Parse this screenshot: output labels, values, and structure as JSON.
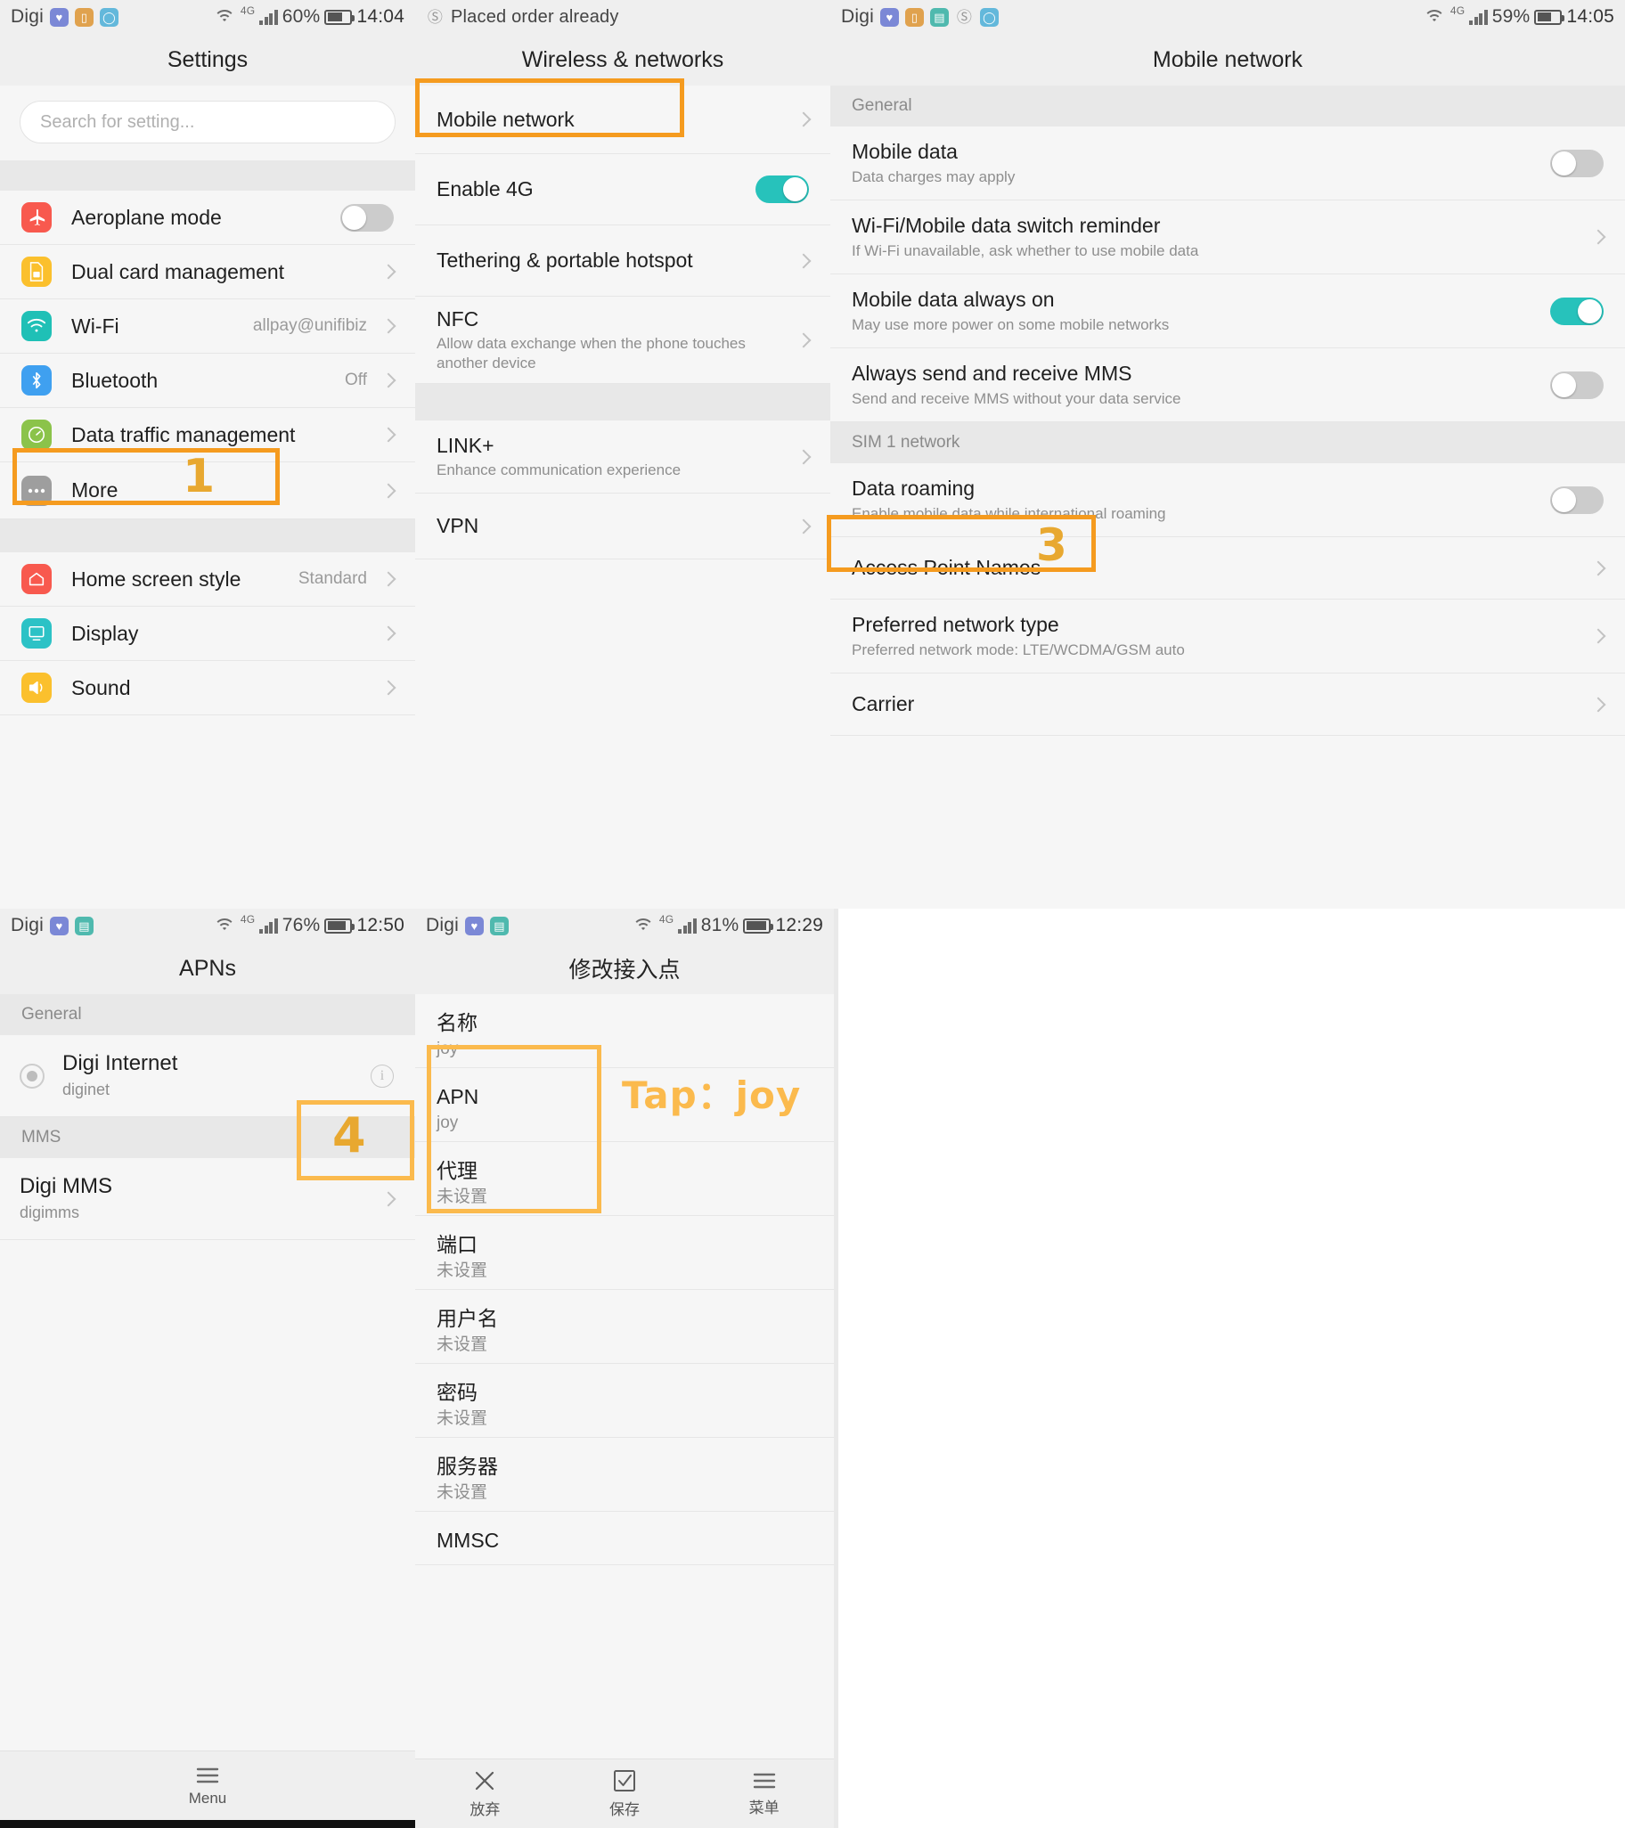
{
  "accent": {
    "strong": "#F59B1F",
    "soft": "#FBBA4D",
    "number": "#E8A830",
    "toggle_on": "#27c2bb"
  },
  "panels": {
    "settings": {
      "status": {
        "carrier": "Digi",
        "percent": "60%",
        "clock": "14:04",
        "network": "4G"
      },
      "title": "Settings",
      "search_placeholder": "Search for setting...",
      "items": [
        {
          "label": "Aeroplane mode",
          "value": "",
          "icon": "aeroplane-icon",
          "control": "toggle-off"
        },
        {
          "label": "Dual card management",
          "value": "",
          "icon": "sim-card-icon",
          "control": "chevron"
        },
        {
          "label": "Wi-Fi",
          "value": "allpay@unifibiz",
          "icon": "wifi-icon",
          "control": "chevron"
        },
        {
          "label": "Bluetooth",
          "value": "Off",
          "icon": "bluetooth-icon",
          "control": "chevron"
        },
        {
          "label": "Data traffic management",
          "value": "",
          "icon": "speedometer-icon",
          "control": "chevron"
        },
        {
          "label": "More",
          "value": "",
          "icon": "more-dots-icon",
          "control": "chevron"
        }
      ],
      "items2": [
        {
          "label": "Home screen style",
          "value": "Standard",
          "icon": "home-icon",
          "control": "chevron"
        },
        {
          "label": "Display",
          "value": "",
          "icon": "display-icon",
          "control": "chevron"
        },
        {
          "label": "Sound",
          "value": "",
          "icon": "sound-icon",
          "control": "chevron"
        }
      ],
      "highlight_number": "1"
    },
    "wireless": {
      "status": {
        "notification": "Placed order already"
      },
      "title": "Wireless & networks",
      "items": [
        {
          "label": "Mobile network",
          "sub": "",
          "control": "chevron"
        },
        {
          "label": "Enable 4G",
          "sub": "",
          "control": "toggle-on"
        },
        {
          "label": "Tethering & portable hotspot",
          "sub": "",
          "control": "chevron"
        },
        {
          "label": "NFC",
          "sub": "Allow data exchange when the phone touches another device",
          "control": "chevron"
        }
      ],
      "items2": [
        {
          "label": "LINK+",
          "sub": "Enhance communication experience",
          "control": "chevron"
        },
        {
          "label": "VPN",
          "sub": "",
          "control": "chevron"
        }
      ]
    },
    "mobile_network": {
      "status": {
        "carrier": "Digi",
        "percent": "59%",
        "clock": "14:05",
        "network": "4G"
      },
      "title": "Mobile network",
      "group_general": "General",
      "general_items": [
        {
          "label": "Mobile data",
          "sub": "Data charges may apply",
          "control": "toggle-off"
        },
        {
          "label": "Wi-Fi/Mobile data switch reminder",
          "sub": "If Wi-Fi unavailable, ask whether to use mobile data",
          "control": "chevron"
        },
        {
          "label": "Mobile data always on",
          "sub": "May use more power on some mobile networks",
          "control": "toggle-on"
        },
        {
          "label": "Always send and receive MMS",
          "sub": "Send and receive MMS without your data service",
          "control": "toggle-off"
        }
      ],
      "group_sim": "SIM 1 network",
      "sim_items": [
        {
          "label": "Data roaming",
          "sub": "Enable mobile data while international roaming",
          "control": "toggle-off"
        },
        {
          "label": "Access Point Names",
          "sub": "",
          "control": "chevron"
        },
        {
          "label": "Preferred network type",
          "sub": "Preferred network mode: LTE/WCDMA/GSM auto",
          "control": "chevron"
        },
        {
          "label": "Carrier",
          "sub": "",
          "control": "chevron"
        }
      ],
      "highlight_number": "3"
    },
    "apns": {
      "status": {
        "carrier": "Digi",
        "percent": "76%",
        "clock": "12:50",
        "network": "4G"
      },
      "title": "APNs",
      "group_general": "General",
      "entry_general": {
        "name": "Digi Internet",
        "apn": "diginet"
      },
      "group_mms": "MMS",
      "entry_mms": {
        "name": "Digi MMS",
        "apn": "digimms"
      },
      "bottom": {
        "menu_label": "Menu",
        "menu_icon": "hamburger-icon"
      },
      "highlight_number": "4"
    },
    "edit_apn": {
      "status": {
        "carrier": "Digi",
        "percent": "81%",
        "clock": "12:29",
        "network": "4G"
      },
      "title": "修改接入点",
      "annotation": "Tap：joy",
      "fields": [
        {
          "label": "名称",
          "value": "joy"
        },
        {
          "label": "APN",
          "value": "joy"
        },
        {
          "label": "代理",
          "value": "未设置"
        },
        {
          "label": "端口",
          "value": "未设置"
        },
        {
          "label": "用户名",
          "value": "未设置"
        },
        {
          "label": "密码",
          "value": "未设置"
        },
        {
          "label": "服务器",
          "value": "未设置"
        },
        {
          "label": "MMSC",
          "value": ""
        }
      ],
      "bottom": [
        {
          "label": "放弃",
          "icon": "close-x-icon"
        },
        {
          "label": "保存",
          "icon": "check-box-icon"
        },
        {
          "label": "菜单",
          "icon": "hamburger-icon"
        }
      ]
    }
  }
}
